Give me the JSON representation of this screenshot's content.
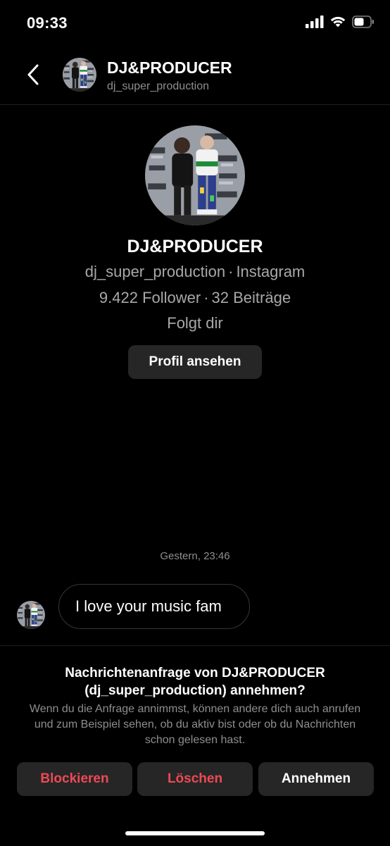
{
  "status_bar": {
    "time": "09:33",
    "icons": [
      "cellular-signal-icon",
      "wifi-icon",
      "battery-icon"
    ]
  },
  "header": {
    "back_icon": "chevron-left-icon",
    "name": "DJ&PRODUCER",
    "username": "dj_super_production"
  },
  "profile": {
    "name": "DJ&PRODUCER",
    "username": "dj_super_production",
    "platform": "Instagram",
    "separator": "·",
    "followers": "9.422 Follower",
    "posts": "32 Beiträge",
    "follows_you": "Folgt dir",
    "view_profile_label": "Profil ansehen",
    "photo_sign_text": "POWER 106 FM"
  },
  "conversation": {
    "timestamp": "Gestern, 23:46",
    "messages": [
      {
        "text": "I love your music fam"
      }
    ]
  },
  "request": {
    "title": "Nachrichtenanfrage von DJ&PRODUCER (dj_super_production) annehmen?",
    "description": "Wenn du die Anfrage annimmst, können andere dich auch anrufen und zum Beispiel sehen, ob du aktiv bist oder ob du Nachrichten schon gelesen hast.",
    "block_label": "Blockieren",
    "delete_label": "Löschen",
    "accept_label": "Annehmen"
  },
  "colors": {
    "background": "#000000",
    "button_background": "#262626",
    "secondary_text": "#8e8e8e",
    "danger": "#ed4956"
  }
}
